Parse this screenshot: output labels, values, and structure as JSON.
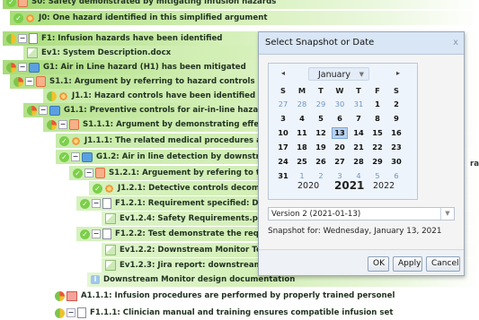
{
  "tree": {
    "rows": [
      {
        "text": "S0: Safety demonstrated by mitigating infusion hazards"
      },
      {
        "text": "J0: One hazard identified in this simplified argument"
      },
      {
        "text": "F1: Infusion hazards have been identified"
      },
      {
        "text": "Ev1: System Description.docx"
      },
      {
        "text": "G1: Air in Line hazard (H1) has been mitigated"
      },
      {
        "text": "S1.1: Argument by referring to hazard controls"
      },
      {
        "text": "J1.1: Hazard controls have been identified durin"
      },
      {
        "text": "G1.1: Preventive controls for air-in-line hazard a"
      },
      {
        "text": "S1.1.1: Argument by demonstrating effective"
      },
      {
        "text": "J1.1.1: The related medical procedures ar"
      },
      {
        "text": "G1.2: Air in line detection by downstream"
      },
      {
        "text": "S1.2.1: Arguement by refering to the re"
      },
      {
        "text": "J1.2.1: Detective controls decompo"
      },
      {
        "text": "F1.2.1: Requirement specified: Dow"
      },
      {
        "text": "Ev1.2.4: Safety Requirements.pd"
      },
      {
        "text": "F1.2.2: Test demonstrate the requir"
      },
      {
        "text": "Ev1.2.2: Downstream Monitor Te"
      },
      {
        "text": "Ev1.2.3: Jira report: downstream"
      },
      {
        "text": "Downstream Monitor design documentation"
      },
      {
        "text": "A1.1.1: Infusion procedures are performed by properly trained personel"
      },
      {
        "text": "F1.1.1: Clinician manual and training ensures compatible infusion set"
      }
    ],
    "cut_text": "rain"
  },
  "dialog": {
    "title": "Select Snapshot or Date",
    "close": "x",
    "calendar": {
      "month": "January",
      "prev": "◂",
      "next": "▸",
      "weekdays": [
        "S",
        "M",
        "T",
        "W",
        "T",
        "F",
        "S"
      ],
      "days": [
        [
          "27",
          "28",
          "29",
          "30",
          "31",
          "1",
          "2"
        ],
        [
          "3",
          "4",
          "5",
          "6",
          "7",
          "8",
          "9"
        ],
        [
          "10",
          "11",
          "12",
          "13",
          "14",
          "15",
          "16"
        ],
        [
          "17",
          "18",
          "19",
          "20",
          "21",
          "22",
          "23"
        ],
        [
          "24",
          "25",
          "26",
          "27",
          "28",
          "29",
          "30"
        ],
        [
          "31",
          "1",
          "2",
          "3",
          "4",
          "5",
          "6"
        ]
      ],
      "selected_day": "13",
      "years": [
        "2020",
        "2021",
        "2022"
      ]
    },
    "version_value": "Version 2 (2021-01-13)",
    "snapshot_text": "Snapshot for:  Wednesday, January 13, 2021",
    "buttons": {
      "ok": "OK",
      "apply": "Apply",
      "cancel": "Cancel"
    },
    "colors": {
      "title_bar": "#d9e6f5",
      "selected_day": "#b7d1ee",
      "tree_green": "#b9e48e"
    }
  }
}
